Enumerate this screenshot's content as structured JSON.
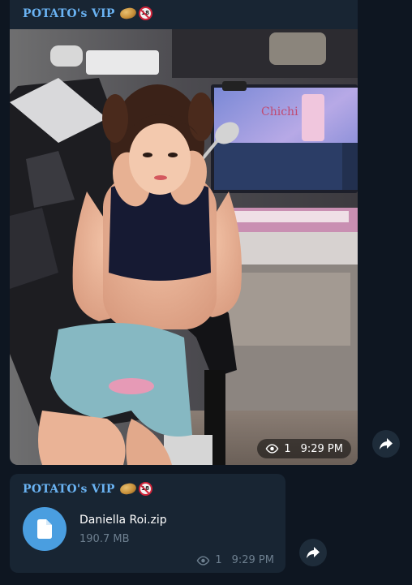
{
  "messages": [
    {
      "sender": "POTATO's VIP",
      "sender_emojis": [
        "potato-emoji",
        "no-under-18-emoji"
      ],
      "emoji_18_text": "18",
      "media": "photo",
      "views": "1",
      "time": "9:29 PM",
      "screen_text": "Chichi"
    },
    {
      "sender": "POTATO's VIP",
      "sender_emojis": [
        "potato-emoji",
        "no-under-18-emoji"
      ],
      "emoji_18_text": "18",
      "file": {
        "name": "Daniella Roi.zip",
        "size": "190.7 MB",
        "icon": "file-icon"
      },
      "views": "1",
      "time": "9:29 PM"
    }
  ],
  "icons": {
    "share": "share-arrow-icon",
    "views": "eye-icon"
  },
  "colors": {
    "background": "#0e1621",
    "bubble": "#182533",
    "sender_name": "#6ab3f3",
    "file_icon": "#4a9ee0",
    "meta_text": "#6d7f8f"
  }
}
